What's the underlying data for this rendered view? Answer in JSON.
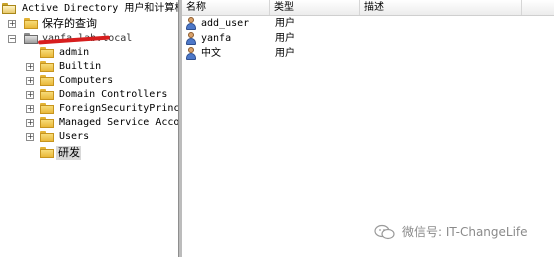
{
  "tree": {
    "root_label": "Active Directory 用户和计算机",
    "saved_queries_label": "保存的查询",
    "domain_label": "yanfa.lab.local",
    "children": [
      {
        "label": "admin",
        "expander": ""
      },
      {
        "label": "Builtin",
        "expander": "+"
      },
      {
        "label": "Computers",
        "expander": "+"
      },
      {
        "label": "Domain Controllers",
        "expander": "+"
      },
      {
        "label": "ForeignSecurityPrincip",
        "expander": "+"
      },
      {
        "label": "Managed Service Accour",
        "expander": "+"
      },
      {
        "label": "Users",
        "expander": "+"
      },
      {
        "label": "研发",
        "expander": ""
      }
    ]
  },
  "list": {
    "columns": [
      "名称",
      "类型",
      "描述"
    ],
    "rows": [
      {
        "name": "add_user",
        "type": "用户",
        "icon": "user-icon"
      },
      {
        "name": "yanfa",
        "type": "用户",
        "icon": "user-icon"
      },
      {
        "name": "中文",
        "type": "用户",
        "icon": "user-icon"
      }
    ]
  },
  "watermark": {
    "text": "微信号: IT-ChangeLife",
    "icon": "wechat-icon"
  },
  "colors": {
    "folder": "#f2c94c",
    "redaction": "#d71e1e",
    "selection": "#d9d9d9"
  }
}
